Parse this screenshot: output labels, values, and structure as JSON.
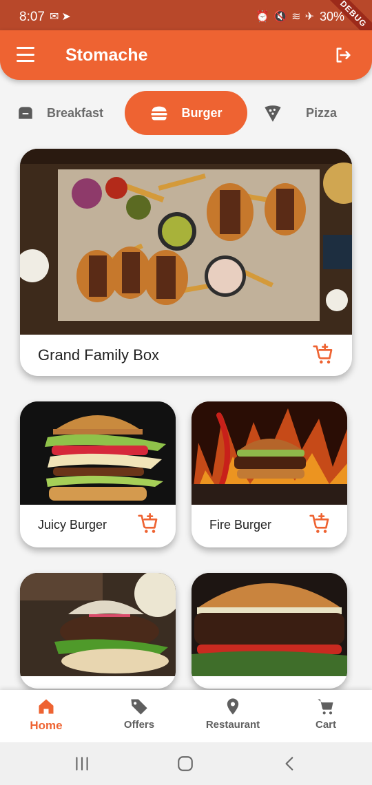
{
  "status_bar": {
    "time": "8:07",
    "battery": "30%",
    "debug_label": "DEBUG"
  },
  "app_bar": {
    "title": "Stomache"
  },
  "categories": [
    {
      "label": "Breakfast",
      "icon": "toaster-icon",
      "selected": false
    },
    {
      "label": "Burger",
      "icon": "burger-icon",
      "selected": true
    },
    {
      "label": "Pizza",
      "icon": "pizza-icon",
      "selected": false
    }
  ],
  "featured": {
    "name": "Grand Family Box",
    "icon": "add-to-cart-icon"
  },
  "items": [
    {
      "name": "Juicy Burger",
      "icon": "add-to-cart-icon"
    },
    {
      "name": "Fire Burger",
      "icon": "add-to-cart-icon"
    }
  ],
  "bottom_nav": [
    {
      "label": "Home",
      "icon": "home-icon",
      "active": true
    },
    {
      "label": "Offers",
      "icon": "tag-icon",
      "active": false
    },
    {
      "label": "Restaurant",
      "icon": "location-pin-icon",
      "active": false
    },
    {
      "label": "Cart",
      "icon": "cart-icon",
      "active": false
    }
  ],
  "colors": {
    "primary": "#ee6332",
    "status_bar": "#b8482a",
    "inactive_text": "#6b6b6b",
    "background": "#f4f4f4"
  }
}
